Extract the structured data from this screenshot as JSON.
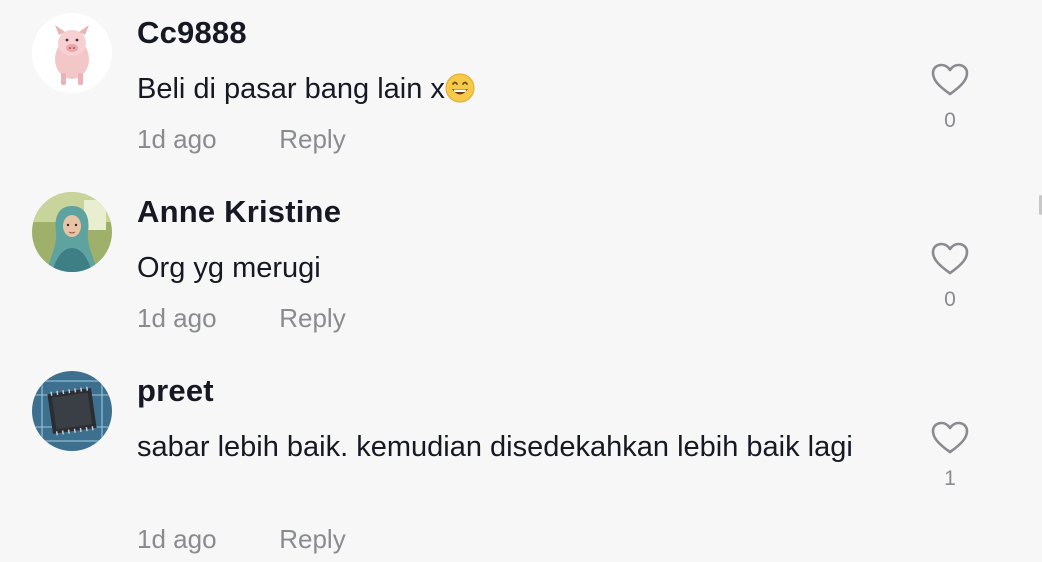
{
  "comments": [
    {
      "username": "Cc9888",
      "text": "Beli di pasar bang lain x",
      "emoji_icon": "grinning-face-emoji",
      "time": "1d ago",
      "reply_label": "Reply",
      "likes": "0",
      "avatar_icon": "pig-avatar"
    },
    {
      "username": "Anne Kristine",
      "text": "Org yg merugi",
      "time": "1d ago",
      "reply_label": "Reply",
      "likes": "0",
      "avatar_icon": "profile-photo-avatar"
    },
    {
      "username": "preet",
      "text": "sabar lebih baik. kemudian disedekahkan lebih baik lagi",
      "time": "1d ago",
      "reply_label": "Reply",
      "likes": "1",
      "avatar_icon": "circuit-chip-avatar"
    }
  ],
  "colors": {
    "background": "#f7f7f7",
    "username": "#161823",
    "meta": "#8a8b91",
    "heart_outline": "#8a8b91"
  }
}
